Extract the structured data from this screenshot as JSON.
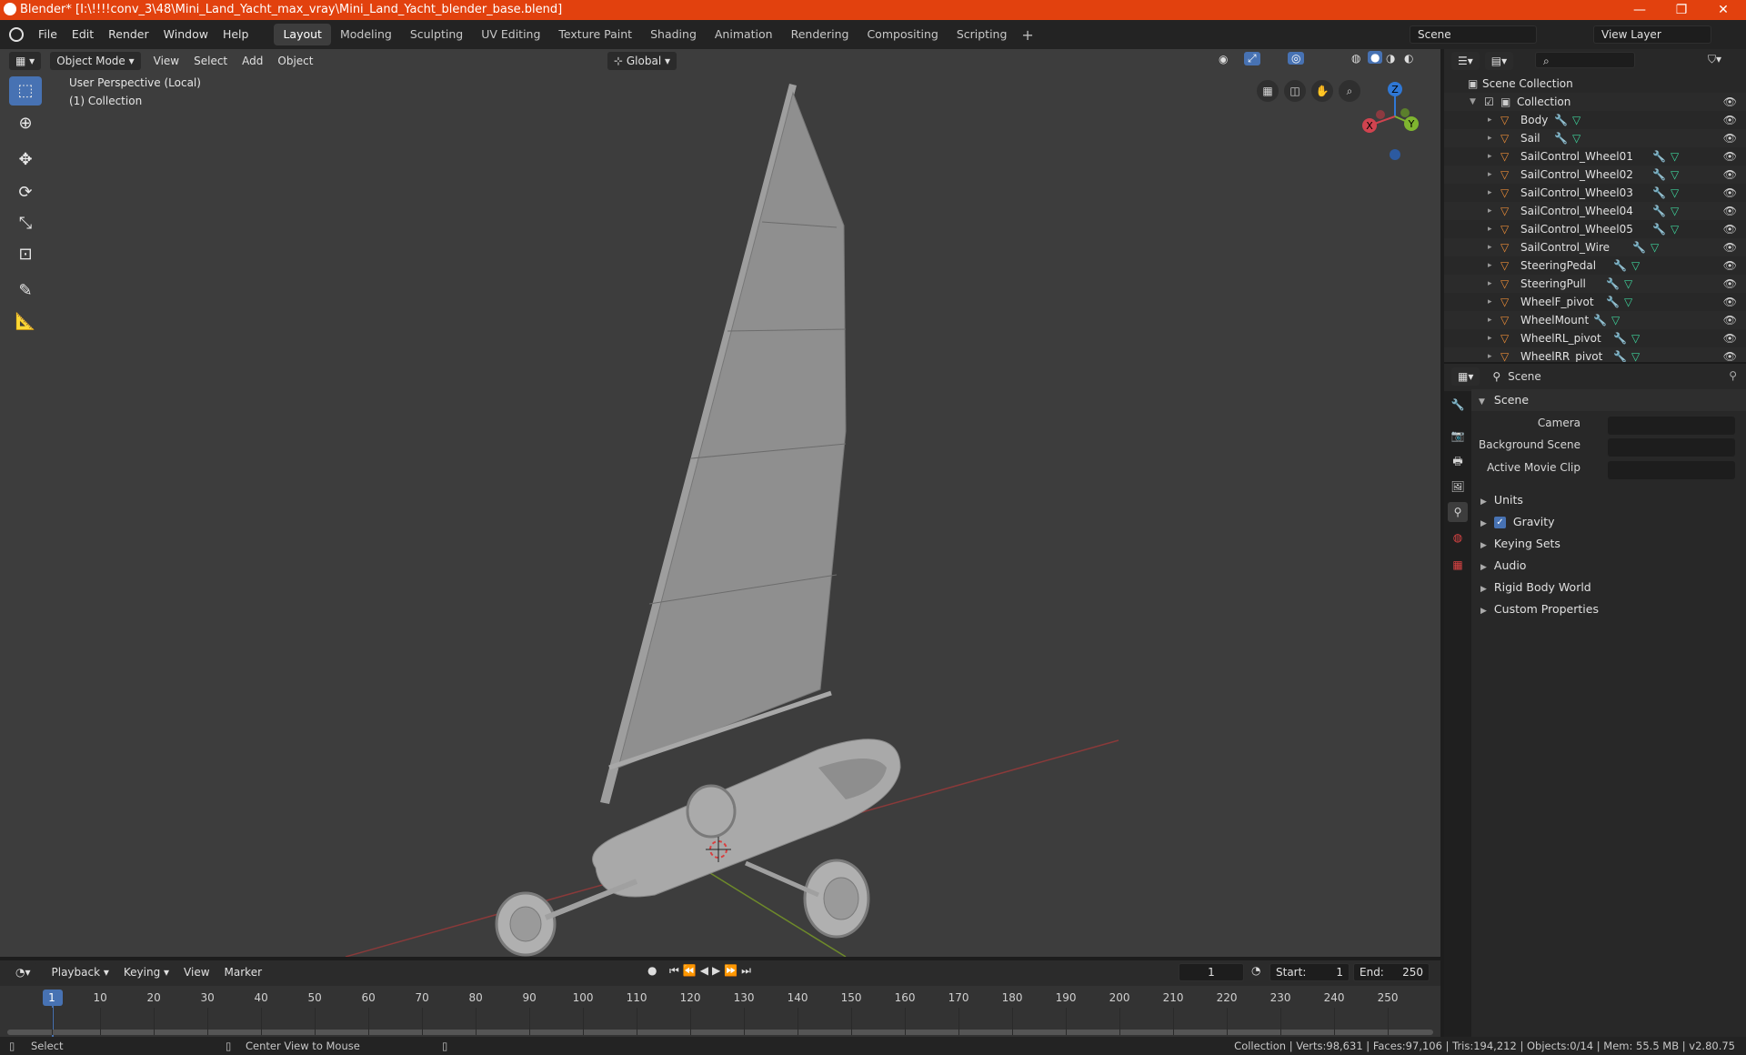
{
  "titlebar": {
    "title": "Blender* [I:\\!!!!conv_3\\48\\Mini_Land_Yacht_max_vray\\Mini_Land_Yacht_blender_base.blend]",
    "minimize": "—",
    "restore": "❐",
    "close": "✕"
  },
  "menubar": {
    "items": [
      "File",
      "Edit",
      "Render",
      "Window",
      "Help"
    ]
  },
  "workspaces": [
    "Layout",
    "Modeling",
    "Sculpting",
    "UV Editing",
    "Texture Paint",
    "Shading",
    "Animation",
    "Rendering",
    "Compositing",
    "Scripting"
  ],
  "active_workspace": "Layout",
  "scene_field": "Scene",
  "view_layer_field": "View Layer",
  "viewport": {
    "mode": "Object Mode",
    "menus": [
      "View",
      "Select",
      "Add",
      "Object"
    ],
    "orientation": "Global",
    "info_line1": "User Perspective (Local)",
    "info_line2": "(1) Collection",
    "gizmo": {
      "x": "X",
      "y": "Y",
      "z": "Z"
    }
  },
  "outliner": {
    "root": "Scene Collection",
    "collection": "Collection",
    "objects": [
      "Body",
      "Sail",
      "SailControl_Wheel01",
      "SailControl_Wheel02",
      "SailControl_Wheel03",
      "SailControl_Wheel04",
      "SailControl_Wheel05",
      "SailControl_Wire",
      "SteeringPedal",
      "SteeringPull",
      "WheelF_pivot",
      "WheelMount",
      "WheelRL_pivot",
      "WheelRR_pivot"
    ]
  },
  "properties": {
    "context": "Scene",
    "panel_title": "Scene",
    "camera_label": "Camera",
    "background_scene_label": "Background Scene",
    "active_movie_clip_label": "Active Movie Clip",
    "subpanels": [
      "Units",
      "Gravity",
      "Keying Sets",
      "Audio",
      "Rigid Body World",
      "Custom Properties"
    ],
    "gravity_checked": true
  },
  "timeline": {
    "menus": [
      "Playback",
      "Keying",
      "View",
      "Marker"
    ],
    "current_frame": "1",
    "start_label": "Start:",
    "start": "1",
    "end_label": "End:",
    "end": "250",
    "ticks": [
      "1",
      "10",
      "20",
      "30",
      "40",
      "50",
      "60",
      "70",
      "80",
      "90",
      "100",
      "110",
      "120",
      "130",
      "140",
      "150",
      "160",
      "170",
      "180",
      "190",
      "200",
      "210",
      "220",
      "230",
      "240",
      "250"
    ]
  },
  "statusbar": {
    "select": "Select",
    "center_view": "Center View to Mouse",
    "stats": "Collection | Verts:98,631 | Faces:97,106 | Tris:194,212 | Objects:0/14 | Mem: 55.5 MB | v2.80.75"
  },
  "colors": {
    "accent": "#4772b3",
    "titlebar": "#e2410e",
    "mesh": "#e98b37"
  }
}
